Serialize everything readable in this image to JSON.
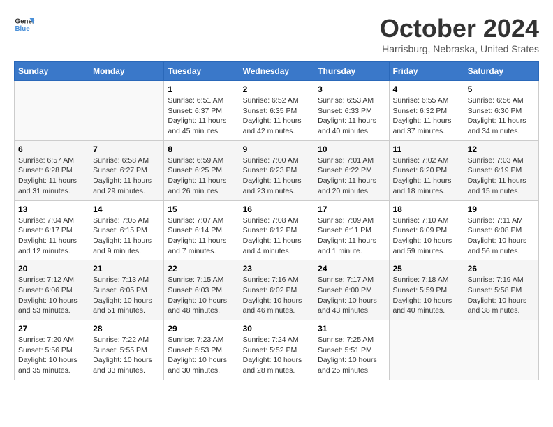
{
  "header": {
    "logo_line1": "General",
    "logo_line2": "Blue",
    "title": "October 2024",
    "location": "Harrisburg, Nebraska, United States"
  },
  "weekdays": [
    "Sunday",
    "Monday",
    "Tuesday",
    "Wednesday",
    "Thursday",
    "Friday",
    "Saturday"
  ],
  "weeks": [
    [
      {
        "day": "",
        "sunrise": "",
        "sunset": "",
        "daylight": ""
      },
      {
        "day": "",
        "sunrise": "",
        "sunset": "",
        "daylight": ""
      },
      {
        "day": "1",
        "sunrise": "Sunrise: 6:51 AM",
        "sunset": "Sunset: 6:37 PM",
        "daylight": "Daylight: 11 hours and 45 minutes."
      },
      {
        "day": "2",
        "sunrise": "Sunrise: 6:52 AM",
        "sunset": "Sunset: 6:35 PM",
        "daylight": "Daylight: 11 hours and 42 minutes."
      },
      {
        "day": "3",
        "sunrise": "Sunrise: 6:53 AM",
        "sunset": "Sunset: 6:33 PM",
        "daylight": "Daylight: 11 hours and 40 minutes."
      },
      {
        "day": "4",
        "sunrise": "Sunrise: 6:55 AM",
        "sunset": "Sunset: 6:32 PM",
        "daylight": "Daylight: 11 hours and 37 minutes."
      },
      {
        "day": "5",
        "sunrise": "Sunrise: 6:56 AM",
        "sunset": "Sunset: 6:30 PM",
        "daylight": "Daylight: 11 hours and 34 minutes."
      }
    ],
    [
      {
        "day": "6",
        "sunrise": "Sunrise: 6:57 AM",
        "sunset": "Sunset: 6:28 PM",
        "daylight": "Daylight: 11 hours and 31 minutes."
      },
      {
        "day": "7",
        "sunrise": "Sunrise: 6:58 AM",
        "sunset": "Sunset: 6:27 PM",
        "daylight": "Daylight: 11 hours and 29 minutes."
      },
      {
        "day": "8",
        "sunrise": "Sunrise: 6:59 AM",
        "sunset": "Sunset: 6:25 PM",
        "daylight": "Daylight: 11 hours and 26 minutes."
      },
      {
        "day": "9",
        "sunrise": "Sunrise: 7:00 AM",
        "sunset": "Sunset: 6:23 PM",
        "daylight": "Daylight: 11 hours and 23 minutes."
      },
      {
        "day": "10",
        "sunrise": "Sunrise: 7:01 AM",
        "sunset": "Sunset: 6:22 PM",
        "daylight": "Daylight: 11 hours and 20 minutes."
      },
      {
        "day": "11",
        "sunrise": "Sunrise: 7:02 AM",
        "sunset": "Sunset: 6:20 PM",
        "daylight": "Daylight: 11 hours and 18 minutes."
      },
      {
        "day": "12",
        "sunrise": "Sunrise: 7:03 AM",
        "sunset": "Sunset: 6:19 PM",
        "daylight": "Daylight: 11 hours and 15 minutes."
      }
    ],
    [
      {
        "day": "13",
        "sunrise": "Sunrise: 7:04 AM",
        "sunset": "Sunset: 6:17 PM",
        "daylight": "Daylight: 11 hours and 12 minutes."
      },
      {
        "day": "14",
        "sunrise": "Sunrise: 7:05 AM",
        "sunset": "Sunset: 6:15 PM",
        "daylight": "Daylight: 11 hours and 9 minutes."
      },
      {
        "day": "15",
        "sunrise": "Sunrise: 7:07 AM",
        "sunset": "Sunset: 6:14 PM",
        "daylight": "Daylight: 11 hours and 7 minutes."
      },
      {
        "day": "16",
        "sunrise": "Sunrise: 7:08 AM",
        "sunset": "Sunset: 6:12 PM",
        "daylight": "Daylight: 11 hours and 4 minutes."
      },
      {
        "day": "17",
        "sunrise": "Sunrise: 7:09 AM",
        "sunset": "Sunset: 6:11 PM",
        "daylight": "Daylight: 11 hours and 1 minute."
      },
      {
        "day": "18",
        "sunrise": "Sunrise: 7:10 AM",
        "sunset": "Sunset: 6:09 PM",
        "daylight": "Daylight: 10 hours and 59 minutes."
      },
      {
        "day": "19",
        "sunrise": "Sunrise: 7:11 AM",
        "sunset": "Sunset: 6:08 PM",
        "daylight": "Daylight: 10 hours and 56 minutes."
      }
    ],
    [
      {
        "day": "20",
        "sunrise": "Sunrise: 7:12 AM",
        "sunset": "Sunset: 6:06 PM",
        "daylight": "Daylight: 10 hours and 53 minutes."
      },
      {
        "day": "21",
        "sunrise": "Sunrise: 7:13 AM",
        "sunset": "Sunset: 6:05 PM",
        "daylight": "Daylight: 10 hours and 51 minutes."
      },
      {
        "day": "22",
        "sunrise": "Sunrise: 7:15 AM",
        "sunset": "Sunset: 6:03 PM",
        "daylight": "Daylight: 10 hours and 48 minutes."
      },
      {
        "day": "23",
        "sunrise": "Sunrise: 7:16 AM",
        "sunset": "Sunset: 6:02 PM",
        "daylight": "Daylight: 10 hours and 46 minutes."
      },
      {
        "day": "24",
        "sunrise": "Sunrise: 7:17 AM",
        "sunset": "Sunset: 6:00 PM",
        "daylight": "Daylight: 10 hours and 43 minutes."
      },
      {
        "day": "25",
        "sunrise": "Sunrise: 7:18 AM",
        "sunset": "Sunset: 5:59 PM",
        "daylight": "Daylight: 10 hours and 40 minutes."
      },
      {
        "day": "26",
        "sunrise": "Sunrise: 7:19 AM",
        "sunset": "Sunset: 5:58 PM",
        "daylight": "Daylight: 10 hours and 38 minutes."
      }
    ],
    [
      {
        "day": "27",
        "sunrise": "Sunrise: 7:20 AM",
        "sunset": "Sunset: 5:56 PM",
        "daylight": "Daylight: 10 hours and 35 minutes."
      },
      {
        "day": "28",
        "sunrise": "Sunrise: 7:22 AM",
        "sunset": "Sunset: 5:55 PM",
        "daylight": "Daylight: 10 hours and 33 minutes."
      },
      {
        "day": "29",
        "sunrise": "Sunrise: 7:23 AM",
        "sunset": "Sunset: 5:53 PM",
        "daylight": "Daylight: 10 hours and 30 minutes."
      },
      {
        "day": "30",
        "sunrise": "Sunrise: 7:24 AM",
        "sunset": "Sunset: 5:52 PM",
        "daylight": "Daylight: 10 hours and 28 minutes."
      },
      {
        "day": "31",
        "sunrise": "Sunrise: 7:25 AM",
        "sunset": "Sunset: 5:51 PM",
        "daylight": "Daylight: 10 hours and 25 minutes."
      },
      {
        "day": "",
        "sunrise": "",
        "sunset": "",
        "daylight": ""
      },
      {
        "day": "",
        "sunrise": "",
        "sunset": "",
        "daylight": ""
      }
    ]
  ]
}
